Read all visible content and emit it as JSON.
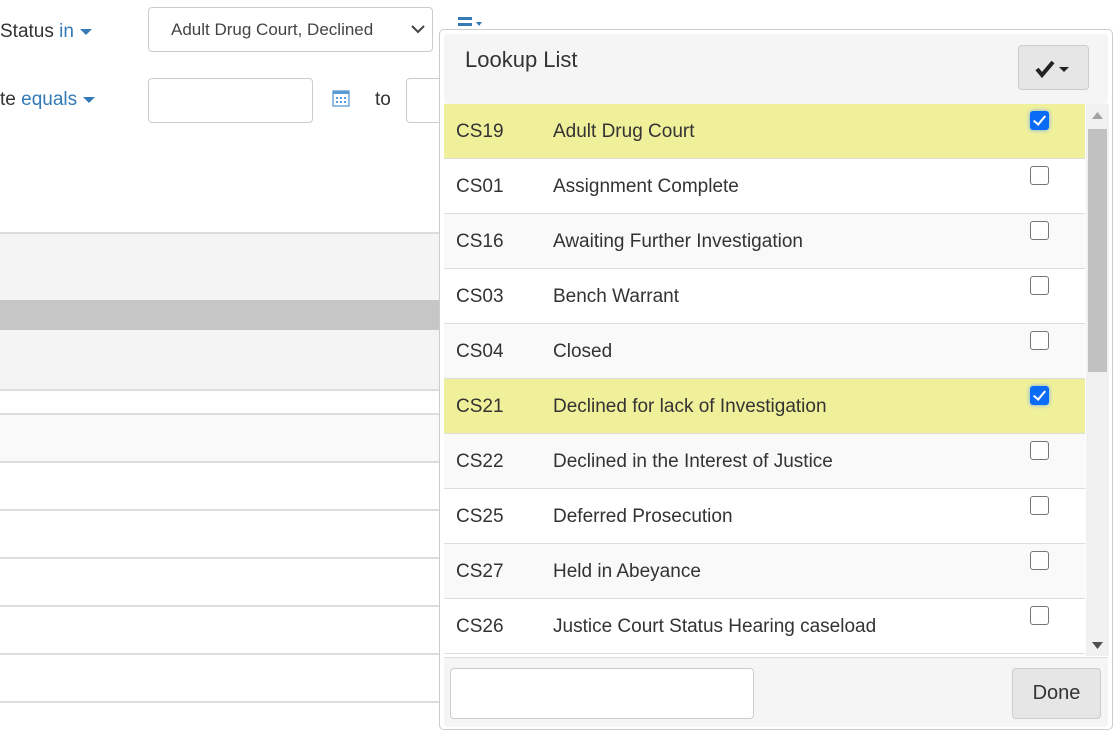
{
  "filters": {
    "status": {
      "field": "Status",
      "operator": "in",
      "value": "Adult Drug Court, Declined"
    },
    "date": {
      "field": "te",
      "operator": "equals",
      "from_value": "",
      "to_label": "to",
      "to_value": ""
    }
  },
  "popup": {
    "title": "Lookup List",
    "items": [
      {
        "code": "CS19",
        "description": "Adult Drug Court",
        "checked": true
      },
      {
        "code": "CS01",
        "description": "Assignment Complete",
        "checked": false
      },
      {
        "code": "CS16",
        "description": "Awaiting Further Investigation",
        "checked": false
      },
      {
        "code": "CS03",
        "description": "Bench Warrant",
        "checked": false
      },
      {
        "code": "CS04",
        "description": "Closed",
        "checked": false
      },
      {
        "code": "CS21",
        "description": "Declined for lack of Investigation",
        "checked": true
      },
      {
        "code": "CS22",
        "description": "Declined in the Interest of Justice",
        "checked": false
      },
      {
        "code": "CS25",
        "description": "Deferred Prosecution",
        "checked": false
      },
      {
        "code": "CS27",
        "description": "Held in Abeyance",
        "checked": false
      },
      {
        "code": "CS26",
        "description": "Justice Court Status Hearing caseload",
        "checked": false
      }
    ],
    "search_value": "",
    "done_label": "Done"
  },
  "colors": {
    "selected_row": "#f0f09a",
    "link": "#337ab7",
    "checkbox": "#0a6cf5"
  }
}
